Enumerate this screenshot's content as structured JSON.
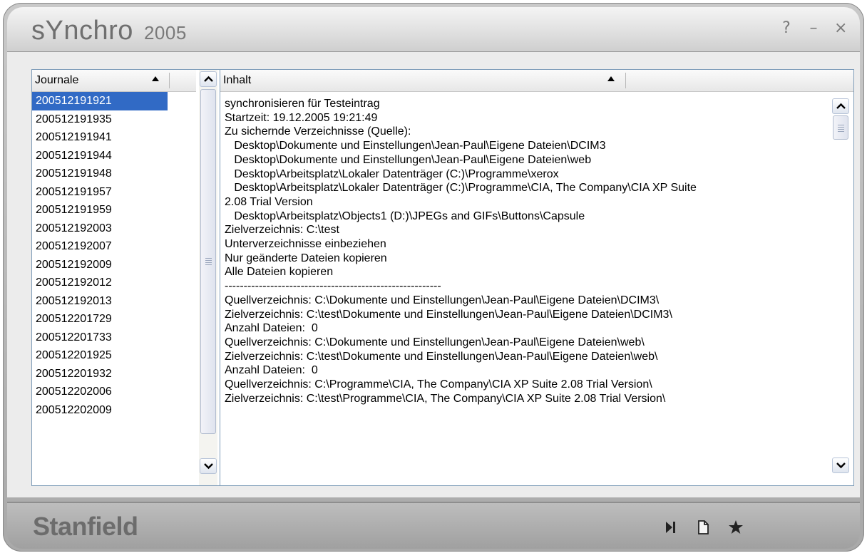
{
  "window": {
    "title": "sYnchro",
    "title_year": "2005",
    "help": "?",
    "minimize": "–",
    "close": "×"
  },
  "journals": {
    "header": "Journale",
    "selected_index": 0,
    "items": [
      "200512191921",
      "200512191935",
      "200512191941",
      "200512191944",
      "200512191948",
      "200512191957",
      "200512191959",
      "200512192003",
      "200512192007",
      "200512192009",
      "200512192012",
      "200512192013",
      "200512201729",
      "200512201733",
      "200512201925",
      "200512201932",
      "200512202006",
      "200512202009"
    ]
  },
  "content": {
    "header": "Inhalt",
    "lines": [
      "synchronisieren für Testeintrag",
      "Startzeit: 19.12.2005 19:21:49",
      "Zu sichernde Verzeichnisse (Quelle):",
      "   Desktop\\Dokumente und Einstellungen\\Jean-Paul\\Eigene Dateien\\DCIM3",
      "   Desktop\\Dokumente und Einstellungen\\Jean-Paul\\Eigene Dateien\\web",
      "   Desktop\\Arbeitsplatz\\Lokaler Datenträger (C:)\\Programme\\xerox",
      "   Desktop\\Arbeitsplatz\\Lokaler Datenträger (C:)\\Programme\\CIA, The Company\\CIA XP Suite",
      "2.08 Trial Version",
      "   Desktop\\Arbeitsplatz\\Objects1 (D:)\\JPEGs and GIFs\\Buttons\\Capsule",
      "Zielverzeichnis: C:\\test",
      "Unterverzeichnisse einbeziehen",
      "Nur geänderte Dateien kopieren",
      "Alle Dateien kopieren",
      "---------------------------------------------------------",
      "Quellverzeichnis: C:\\Dokumente und Einstellungen\\Jean-Paul\\Eigene Dateien\\DCIM3\\",
      "Zielverzeichnis: C:\\test\\Dokumente und Einstellungen\\Jean-Paul\\Eigene Dateien\\DCIM3\\",
      "Anzahl Dateien:  0",
      "Quellverzeichnis: C:\\Dokumente und Einstellungen\\Jean-Paul\\Eigene Dateien\\web\\",
      "Zielverzeichnis: C:\\test\\Dokumente und Einstellungen\\Jean-Paul\\Eigene Dateien\\web\\",
      "Anzahl Dateien:  0",
      "Quellverzeichnis: C:\\Programme\\CIA, The Company\\CIA XP Suite 2.08 Trial Version\\",
      "Zielverzeichnis: C:\\test\\Programme\\CIA, The Company\\CIA XP Suite 2.08 Trial Version\\"
    ]
  },
  "footer": {
    "brand": "Stanfield",
    "icons": [
      "step-forward-icon",
      "new-document-icon",
      "star-icon"
    ]
  }
}
